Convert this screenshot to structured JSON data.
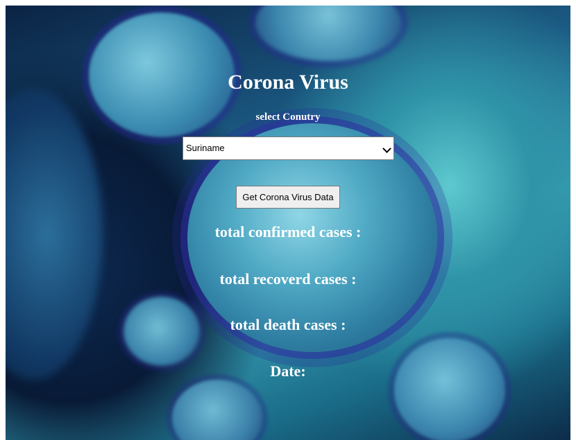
{
  "page": {
    "title": "Corona Virus",
    "select_label": "select Conutry",
    "country_select": {
      "value": "Suriname"
    },
    "get_button_label": "Get Corona Virus Data",
    "stats": {
      "confirmed_label": "total confirmed cases :",
      "recovered_label": "total recoverd cases :",
      "deaths_label": "total death cases :",
      "date_label": "Date:"
    }
  },
  "icons": {
    "select_chevron": "chevron-down-icon"
  },
  "colors": {
    "text": "#ffffff",
    "background_accent": "#3aa0b4"
  }
}
